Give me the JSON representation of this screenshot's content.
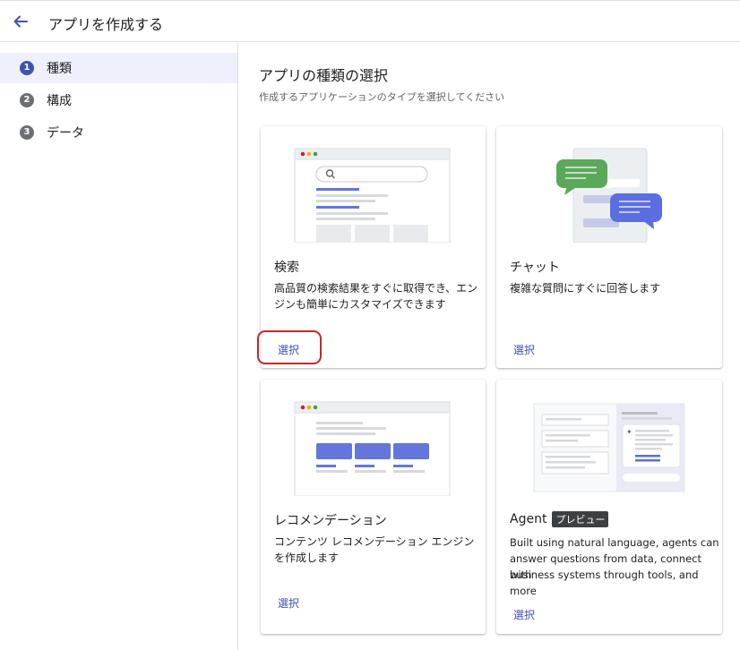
{
  "header": {
    "title": "アプリを作成する",
    "back_icon": "arrow-left-icon"
  },
  "sidebar": {
    "steps": [
      {
        "num": "1",
        "label": "種類"
      },
      {
        "num": "2",
        "label": "構成"
      },
      {
        "num": "3",
        "label": "データ"
      }
    ]
  },
  "main": {
    "title": "アプリの種類の選択",
    "subtitle": "作成するアプリケーションのタイプを選択してください"
  },
  "cards": [
    {
      "title": "検索",
      "desc_line1": "高品質の検索結果をすぐに取得でき、エン",
      "desc_line2": "ジンも簡単にカスタマイズできます",
      "select": "選択"
    },
    {
      "title": "チャット",
      "desc_line1": "複雑な質問にすぐに回答します",
      "select": "選択"
    },
    {
      "title": "レコメンデーション",
      "desc_line1": "コンテンツ レコメンデーション エンジン",
      "desc_line2": "を作成します",
      "select": "選択"
    },
    {
      "title": "Agent",
      "badge": "プレビュー",
      "desc_line1": "Built using natural language, agents can",
      "desc_line2": "answer questions from data, connect with",
      "desc_line3": "business systems through tools, and more",
      "select": "選択"
    }
  ],
  "colors": {
    "accent": "#3f51b5",
    "highlight": "#c62828",
    "chat_green": "#5aa85a",
    "chat_blue": "#5b6ee1"
  }
}
